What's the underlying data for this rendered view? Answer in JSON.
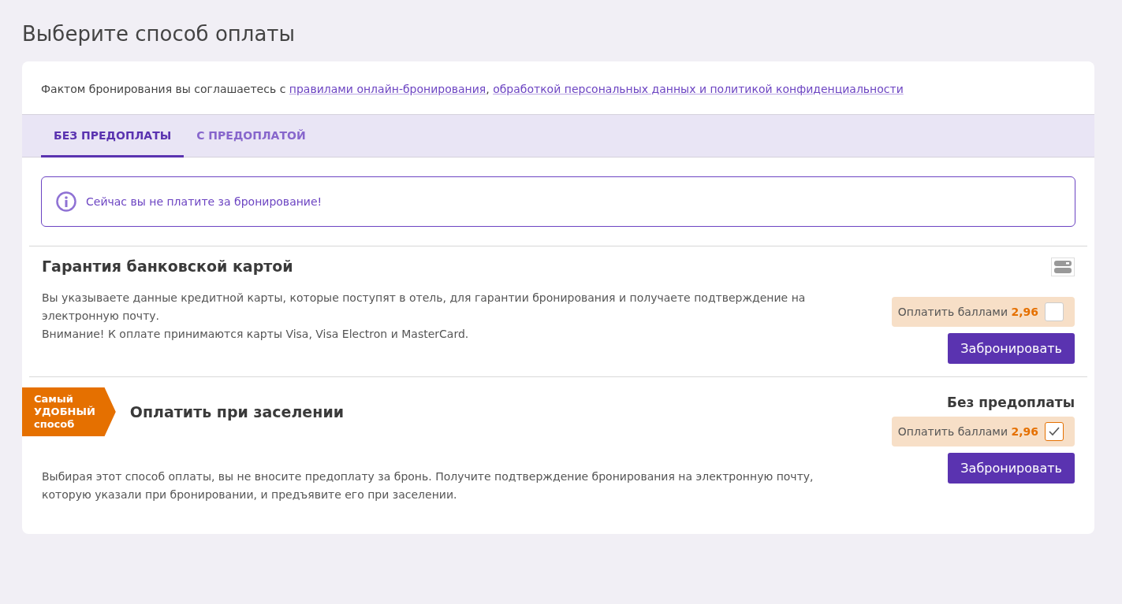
{
  "title": "Выберите способ оплаты",
  "agreement": {
    "text": "Фактом бронирования вы соглашаетесь с ",
    "links": [
      "правилами онлайн-бронирования",
      "обработкой персональных данных и политикой конфиденциальности"
    ],
    "separator": ", "
  },
  "tabs": [
    {
      "label": "БЕЗ ПРЕДОПЛАТЫ",
      "selected": true
    },
    {
      "label": "С ПРЕДОПЛАТОЙ",
      "selected": false
    }
  ],
  "notice": "Сейчас вы не платите за бронирование!",
  "methods": [
    {
      "kind": "card",
      "title": "Гарантия банковской картой",
      "paragraphs": [
        "Вы указываете данные кредитной карты, которые поступят в отель, для гарантии бронирования и получаете подтверждение на электронную почту.",
        "Внимание! К оплате принимаются карты Visa, Visa Electron и MasterCard."
      ],
      "points_label": "Оплатить баллами",
      "points_value": "2,96",
      "points_checked": false,
      "button": "Забронировать"
    },
    {
      "kind": "arrival",
      "badge_lines": [
        "Самый",
        "УДОБНЫЙ",
        "способ"
      ],
      "title": "Оплатить при заселении",
      "paragraphs": [
        "Выбирая этот способ оплаты, вы не вносите предоплату за бронь. Получите подтверждение бронирования на электронную почту, которую указали при бронировании, и предъявите его при заселении."
      ],
      "price_label": "Без предоплаты",
      "points_label": "Оплатить баллами",
      "points_value": "2,96",
      "points_checked": true,
      "button": "Забронировать"
    }
  ]
}
